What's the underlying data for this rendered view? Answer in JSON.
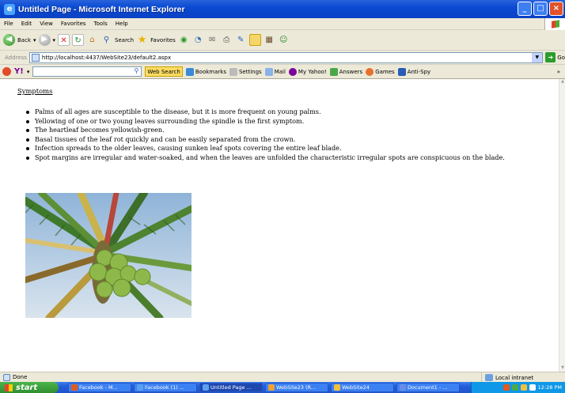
{
  "window": {
    "title": "Untitled Page - Microsoft Internet Explorer",
    "minimize_glyph": "_",
    "maximize_glyph": "□",
    "close_glyph": "×"
  },
  "menu": [
    "File",
    "Edit",
    "View",
    "Favorites",
    "Tools",
    "Help"
  ],
  "toolbar": {
    "back_label": "Back",
    "search_label": "Search",
    "favorites_label": "Favorites"
  },
  "address": {
    "label": "Address",
    "url": "http://localhost:4437/WebSite23/default2.aspx",
    "go_label": "Go"
  },
  "yahoo_toolbar": {
    "search_button": "Web Search",
    "bookmarks": "Bookmarks",
    "settings": "Settings",
    "mail": "Mail",
    "my_yahoo": "My Yahoo!",
    "answers": "Answers",
    "games": "Games",
    "anti_spy": "Anti-Spy"
  },
  "page": {
    "heading": "Symptoms",
    "symptoms": [
      "Palms of all ages are susceptible to the disease, but it is more frequent on young palms.",
      "Yellowing of one or two young leaves surrounding the spindle is the first symptom.",
      "The heartleaf becomes yellowish-green.",
      "Basal tissues of the leaf rot quickly and can be easily separated from the crown.",
      "Infection spreads to the older leaves, causing sunken leaf spots covering the entire leaf blade.",
      "Spot margins are irregular and water-soaked, and when the leaves are unfolded the characteristic irregular spots are conspicuous on the blade."
    ]
  },
  "status": {
    "text": "Done",
    "zone": "Local intranet"
  },
  "taskbar": {
    "start_label": "start",
    "tasks": [
      {
        "label": "Facebook - M...",
        "color": "#e25a1c"
      },
      {
        "label": "Facebook (1) ...",
        "color": "#5aa0f0"
      },
      {
        "label": "Untitled Page ...",
        "color": "#5aa0f0"
      },
      {
        "label": "WebSite23 (R...",
        "color": "#f0a030"
      },
      {
        "label": "WebSite24",
        "color": "#f0c040"
      },
      {
        "label": "Document1 - ...",
        "color": "#6a8ee8"
      }
    ],
    "clock": "12:28 PM"
  }
}
